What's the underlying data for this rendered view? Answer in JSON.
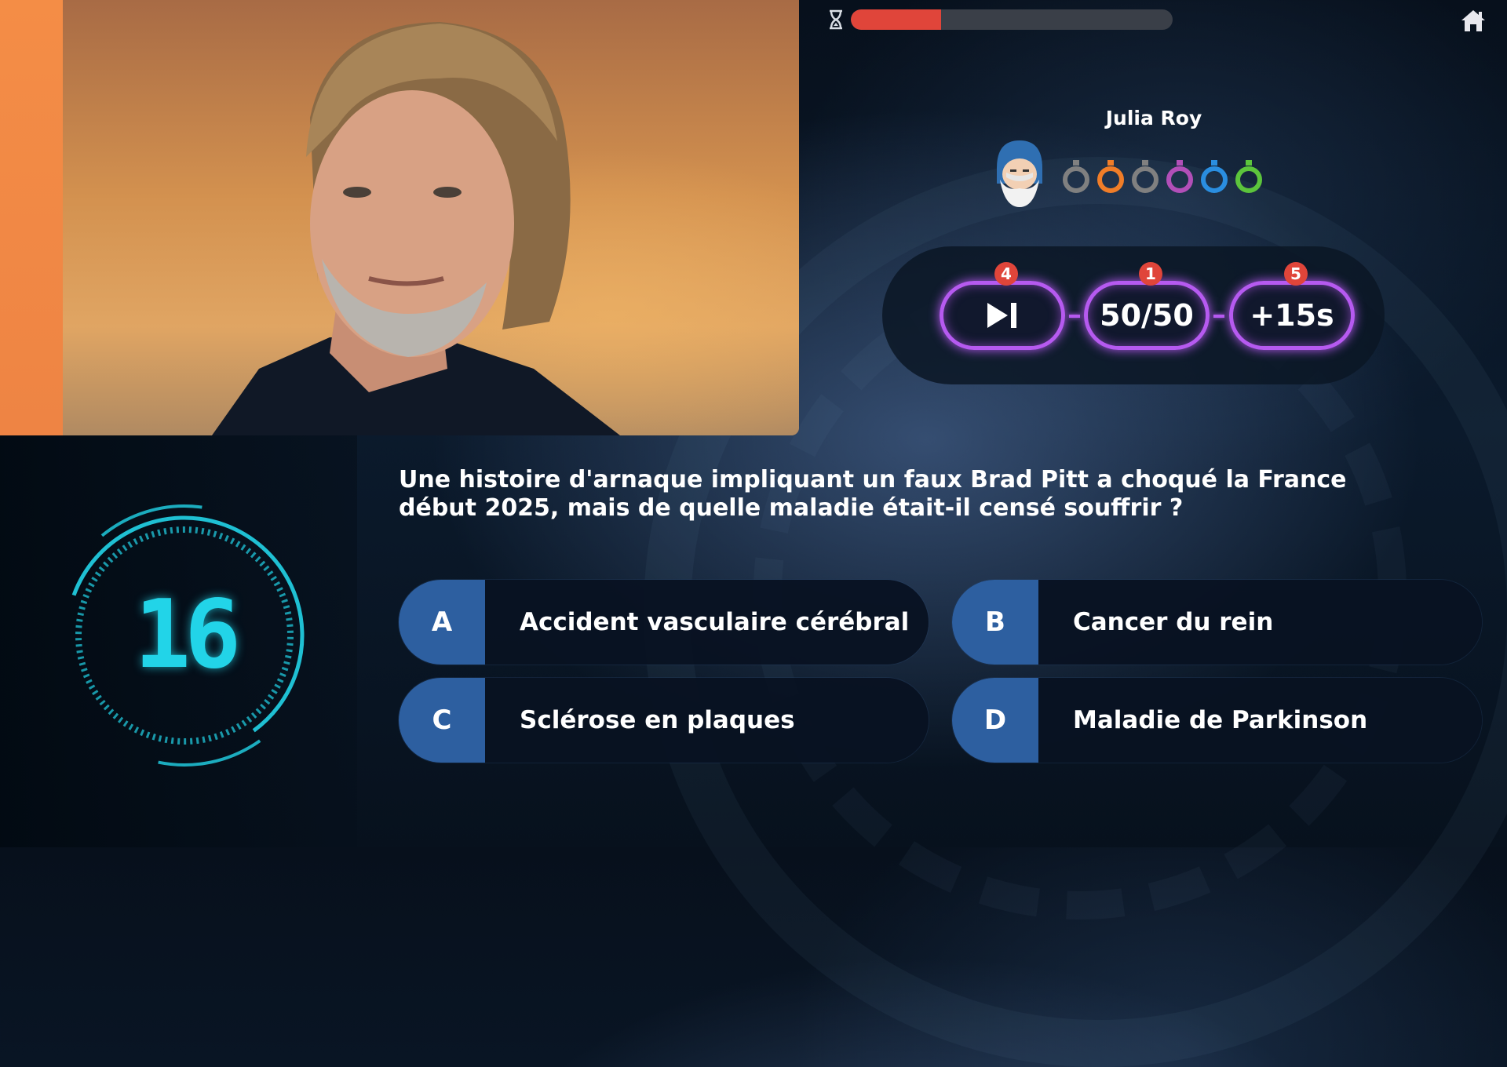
{
  "progress": {
    "fraction": 0.28,
    "colors": {
      "fill": "#e0453a",
      "track": "#3a3f48"
    }
  },
  "icons": {
    "hourglass": "hourglass-icon",
    "home": "home-icon"
  },
  "player": {
    "name": "Julia Roy",
    "avatar": "wizard-avatar",
    "rings": [
      {
        "color": "#808080"
      },
      {
        "color": "#f07d28"
      },
      {
        "color": "#808080"
      },
      {
        "color": "#b24fb8"
      },
      {
        "color": "#2a8ee0"
      },
      {
        "color": "#5cc43c"
      }
    ]
  },
  "jokers": [
    {
      "id": "skip",
      "label": "",
      "icon": "skip-icon",
      "badge": "4"
    },
    {
      "id": "fifty",
      "label": "50/50",
      "badge": "1"
    },
    {
      "id": "time",
      "label": "+15s",
      "badge": "5"
    }
  ],
  "timer": {
    "value": "16",
    "color": "#22d4e8"
  },
  "question": {
    "text": "Une histoire d'arnaque impliquant un faux Brad Pitt a choqué la France début 2025, mais de quelle maladie était-il censé souffrir ?"
  },
  "answers": [
    {
      "letter": "A",
      "text": "Accident vasculaire cérébral"
    },
    {
      "letter": "B",
      "text": "Cancer du rein"
    },
    {
      "letter": "C",
      "text": "Sclérose en plaques"
    },
    {
      "letter": "D",
      "text": "Maladie de Parkinson"
    }
  ]
}
